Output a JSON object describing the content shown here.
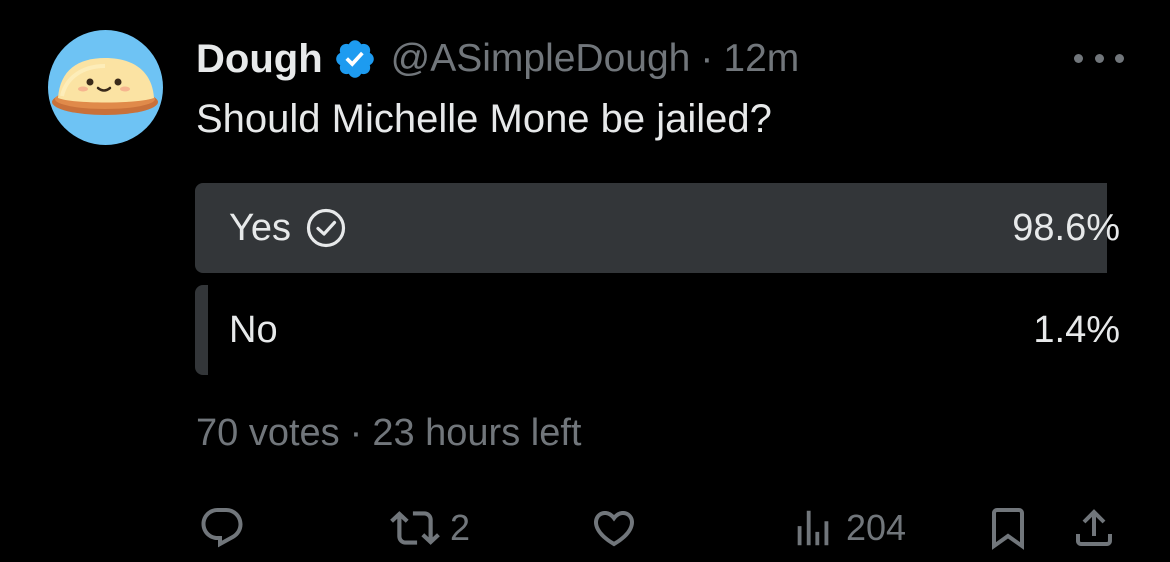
{
  "tweet": {
    "author_name": "Dough",
    "handle": "@ASimpleDough",
    "separator": "·",
    "time": "12m",
    "text": "Should Michelle Mone be jailed?"
  },
  "poll": {
    "options": [
      {
        "label": "Yes",
        "percent_text": "98.6%",
        "percent": 98.6,
        "selected": true
      },
      {
        "label": "No",
        "percent_text": "1.4%",
        "percent": 1.4,
        "selected": false
      }
    ],
    "votes_text": "70 votes",
    "separator": "·",
    "time_left": "23 hours left"
  },
  "actions": {
    "reply_count": "",
    "retweet_count": "2",
    "like_count": "",
    "views_count": "204"
  },
  "icons": [
    "avatar-dough",
    "verified-badge-icon",
    "more-options-icon",
    "check-circle-icon",
    "reply-icon",
    "retweet-icon",
    "like-icon",
    "views-icon",
    "bookmark-icon",
    "share-icon"
  ],
  "colors": {
    "background": "#000000",
    "primary_text": "#e7e9ea",
    "secondary_text": "#71767b",
    "poll_bar": "#333639",
    "verified": "#1d9bf0",
    "avatar_bg": "#6ec3f4"
  }
}
